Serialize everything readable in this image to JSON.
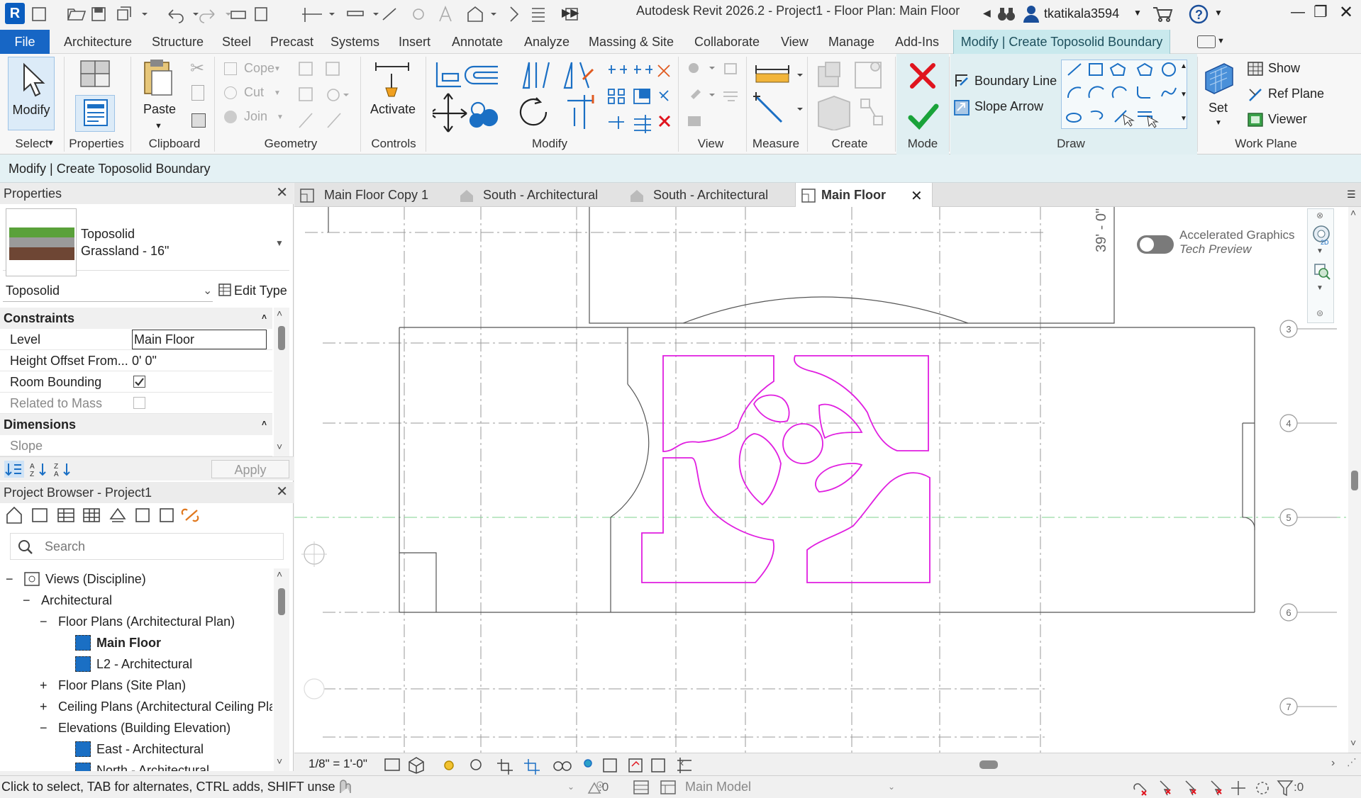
{
  "title_bar": {
    "app_title": "Autodesk Revit 2026.2 - Project1 - Floor Plan: Main Floor",
    "logo": "R",
    "username": "tkatikala3594",
    "colors": {
      "logo_bg": "#0a5dbf",
      "accent": "#1a6fc4"
    }
  },
  "menu_tabs": {
    "file": "File",
    "items": [
      "Architecture",
      "Structure",
      "Steel",
      "Precast",
      "Systems",
      "Insert",
      "Annotate",
      "Analyze",
      "Massing & Site",
      "Collaborate",
      "View",
      "Manage",
      "Add-Ins"
    ],
    "active_context": "Modify | Create Toposolid Boundary"
  },
  "ribbon": {
    "modify": "Modify",
    "select": "Select",
    "properties": "Properties",
    "paste": "Paste",
    "clipboard": "Clipboard",
    "cope": "Cope",
    "cut": "Cut",
    "join": "Join",
    "geometry": "Geometry",
    "activate": "Activate",
    "controls": "Controls",
    "modify_panel": "Modify",
    "view_panel": "View",
    "measure": "Measure",
    "create": "Create",
    "mode": "Mode",
    "boundary_line": "Boundary Line",
    "slope_arrow": "Slope Arrow",
    "draw": "Draw",
    "set": "Set",
    "show": "Show",
    "ref_plane": "Ref  Plane",
    "viewer": "Viewer",
    "work_plane": "Work Plane"
  },
  "context_bar": "Modify | Create Toposolid Boundary",
  "properties": {
    "header": "Properties",
    "type_name": "Toposolid",
    "type_sub": "Grassland - 16\"",
    "selector": "Toposolid",
    "edit_type": "Edit Type",
    "constraints": "Constraints",
    "rows": [
      {
        "k": "Level",
        "v": "Main Floor"
      },
      {
        "k": "Height Offset From...",
        "v": "0'  0\""
      },
      {
        "k": "Room Bounding",
        "v": ""
      },
      {
        "k": "Related to Mass",
        "v": ""
      }
    ],
    "room_bounding_checked": true,
    "related_to_mass_checked": false,
    "dimensions": "Dimensions",
    "slope": "Slope",
    "apply": "Apply"
  },
  "project_browser": {
    "header": "Project Browser - Project1",
    "search_placeholder": "Search",
    "views_root": "Views (Discipline)",
    "architectural": "Architectural",
    "floor_plans": "Floor Plans (Architectural Plan)",
    "main_floor": "Main Floor",
    "l2": "L2 - Architectural",
    "floor_plans_site": "Floor Plans (Site Plan)",
    "ceiling_plans": "Ceiling Plans (Architectural Ceiling Pla",
    "elevations": "Elevations (Building Elevation)",
    "east": "East - Architectural",
    "north": "North - Architectural"
  },
  "view_tabs": [
    {
      "label": "Main Floor Copy 1"
    },
    {
      "label": "South - Architectural"
    },
    {
      "label": "South - Architectural"
    },
    {
      "label": "Main Floor"
    }
  ],
  "canvas": {
    "dimension_text": "39' - 0\"",
    "accel_line1": "Accelerated Graphics",
    "accel_line2": "Tech Preview",
    "grid_bubbles": [
      "3",
      "4",
      "5",
      "6",
      "7"
    ],
    "sketch_color": "#e01ee0"
  },
  "view_control": {
    "scale": "1/8\" = 1'-0\""
  },
  "status_bar": {
    "hint": "Click to select, TAB for alternates, CTRL adds, SHIFT unselect",
    "workset_count": ":0",
    "model": "Main Model",
    "filter_count": ":0"
  }
}
